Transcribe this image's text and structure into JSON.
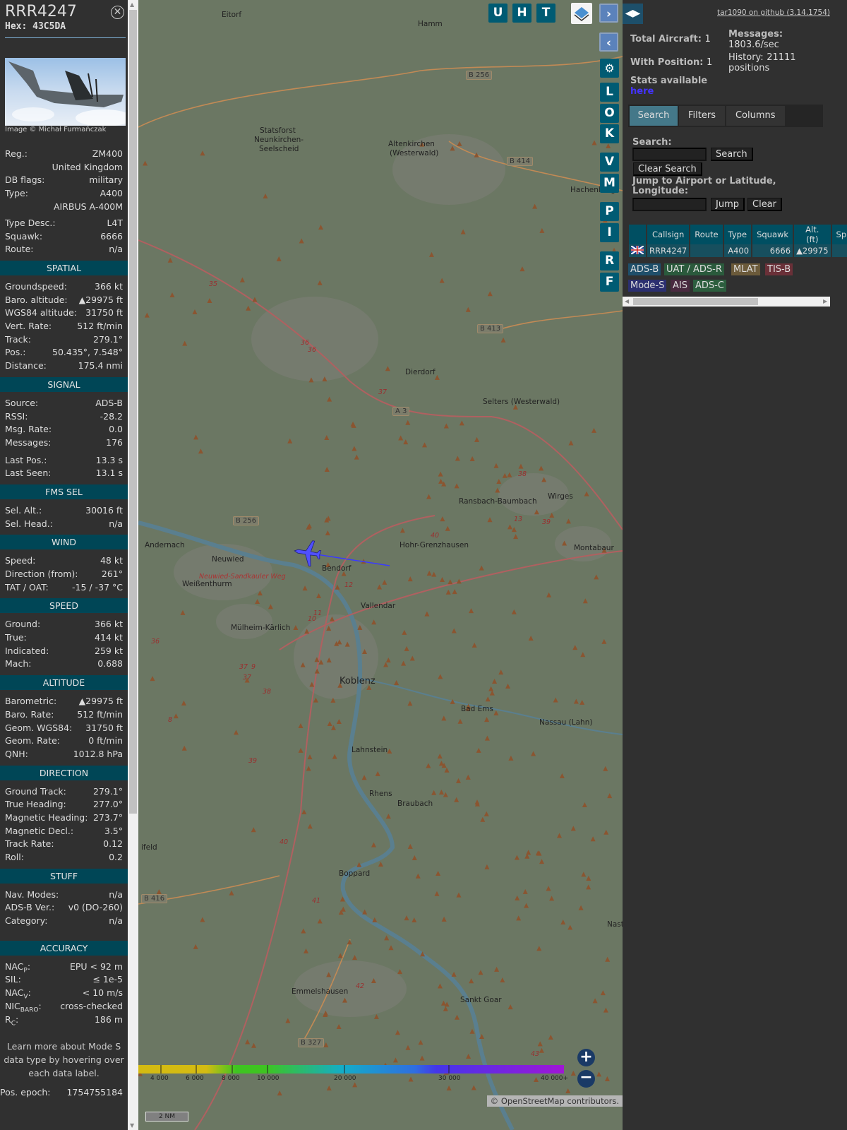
{
  "aircraft": {
    "callsign": "RRR4247",
    "hex_label": "Hex:",
    "hex": "43C5DA",
    "photo_credit": "Image © Michał Furmańczak"
  },
  "info": [
    {
      "label": "Reg.:",
      "value": "ZM400",
      "link": true
    },
    {
      "label": "",
      "value": "United Kingdom"
    },
    {
      "label": "DB flags:",
      "value": "military"
    },
    {
      "label": "Type:",
      "value": "A400"
    },
    {
      "label": "",
      "value": "AIRBUS A-400M"
    },
    {
      "label": "Type Desc.:",
      "value": "L4T",
      "gap": true
    },
    {
      "label": "Squawk:",
      "value": "6666"
    },
    {
      "label": "Route:",
      "value": "n/a"
    }
  ],
  "sections": [
    {
      "title": "SPATIAL",
      "rows": [
        [
          "Groundspeed:",
          "366 kt"
        ],
        [
          "Baro. altitude:",
          "▲29975 ft"
        ],
        [
          "WGS84 altitude:",
          "31750 ft"
        ],
        [
          "Vert. Rate:",
          "512 ft/min"
        ],
        [
          "Track:",
          "279.1°"
        ],
        [
          "Pos.:",
          "50.435°, 7.548°"
        ],
        [
          "Distance:",
          "175.4 nmi"
        ]
      ]
    },
    {
      "title": "SIGNAL",
      "rows": [
        [
          "Source:",
          "ADS-B"
        ],
        [
          "RSSI:",
          "-28.2"
        ],
        [
          "Msg. Rate:",
          "0.0"
        ],
        [
          "Messages:",
          "176"
        ],
        [
          "Last Pos.:",
          "13.3 s"
        ],
        [
          "Last Seen:",
          "13.1 s"
        ]
      ]
    },
    {
      "title": "FMS SEL",
      "rows": [
        [
          "Sel. Alt.:",
          "30016 ft"
        ],
        [
          "Sel. Head.:",
          "n/a"
        ]
      ]
    },
    {
      "title": "WIND",
      "rows": [
        [
          "Speed:",
          "48 kt"
        ],
        [
          "Direction (from):",
          "261°"
        ],
        [
          "TAT / OAT:",
          "-15 / -37 °C"
        ]
      ]
    },
    {
      "title": "SPEED",
      "rows": [
        [
          "Ground:",
          "366 kt"
        ],
        [
          "True:",
          "414 kt"
        ],
        [
          "Indicated:",
          "259 kt"
        ],
        [
          "Mach:",
          "0.688"
        ]
      ]
    },
    {
      "title": "ALTITUDE",
      "rows": [
        [
          "Barometric:",
          "▲29975 ft"
        ],
        [
          "Baro. Rate:",
          "512 ft/min"
        ],
        [
          "Geom. WGS84:",
          "31750 ft"
        ],
        [
          "Geom. Rate:",
          "0 ft/min"
        ],
        [
          "QNH:",
          "1012.8 hPa"
        ]
      ]
    },
    {
      "title": "DIRECTION",
      "rows": [
        [
          "Ground Track:",
          "279.1°"
        ],
        [
          "True Heading:",
          "277.0°"
        ],
        [
          "Magnetic Heading:",
          "273.7°"
        ],
        [
          "Magnetic Decl.:",
          "3.5°"
        ],
        [
          "Track Rate:",
          "0.12"
        ],
        [
          "Roll:",
          "0.2"
        ]
      ]
    },
    {
      "title": "STUFF",
      "rows": [
        [
          "Nav. Modes:",
          "n/a"
        ],
        [
          "ADS-B Ver.:",
          "v0 (DO-260)"
        ],
        [
          "Category:",
          "n/a"
        ]
      ]
    },
    {
      "title": "ACCURACY",
      "rows": [
        [
          "NAC|P|:",
          "EPU < 92 m"
        ],
        [
          "SIL:",
          "≤ 1e-5"
        ],
        [
          "NAC|V|:",
          "< 10 m/s"
        ],
        [
          "NIC|BARO|:",
          "cross-checked"
        ],
        [
          "R|C|:",
          "186 m"
        ]
      ]
    }
  ],
  "note": "Learn more about Mode S data type by hovering over each data label.",
  "pos_epoch": {
    "label": "Pos. epoch:",
    "value": "1754755184"
  },
  "map": {
    "top_buttons": [
      "U",
      "H",
      "T"
    ],
    "side_buttons": [
      "L",
      "O",
      "K",
      "V",
      "M",
      "P",
      "I",
      "R",
      "F"
    ],
    "places": [
      [
        "Eitorf",
        314,
        22
      ],
      [
        "Hamm",
        592,
        35
      ],
      [
        "Statsforst",
        368,
        186
      ],
      [
        "Neunkirchen-",
        360,
        199
      ],
      [
        "Seelscheid",
        367,
        212
      ],
      [
        "Altenkirchen",
        550,
        205
      ],
      [
        "(Westerwald)",
        552,
        218
      ],
      [
        "Hachenburg",
        808,
        270
      ],
      [
        "Dierdorf",
        574,
        528
      ],
      [
        "Selters (Westerwald)",
        684,
        570
      ],
      [
        "Ransbach-Baumbach",
        650,
        711
      ],
      [
        "Wirges",
        776,
        704
      ],
      [
        "Andernach",
        205,
        773
      ],
      [
        "Neuwied",
        300,
        793
      ],
      [
        "Bendorf",
        456,
        806
      ],
      [
        "Hohr-Grenzhausen",
        566,
        773
      ],
      [
        "Montabaur",
        813,
        777
      ],
      [
        "Weißenthurm",
        258,
        828
      ],
      [
        "Vallendar",
        511,
        859
      ],
      [
        "Mülheim-Kärlich",
        327,
        890
      ],
      [
        "Bad Ems",
        653,
        1005
      ],
      [
        "Nassau (Lahn)",
        764,
        1024
      ],
      [
        "Lahnstein",
        498,
        1063
      ],
      [
        "Rhens",
        523,
        1125
      ],
      [
        "Braubach",
        563,
        1139
      ],
      [
        "Boppard",
        480,
        1238
      ],
      [
        "Emmelshausen",
        413,
        1405
      ],
      [
        "Sankt Goar",
        652,
        1417
      ],
      [
        "ifeld",
        200,
        1201
      ],
      [
        "Nast",
        860,
        1310
      ]
    ],
    "big_places": [
      [
        "Koblenz",
        481,
        965
      ]
    ],
    "road_shields": [
      [
        "B 256",
        660,
        108
      ],
      [
        "B 414",
        718,
        230
      ],
      [
        "B 413",
        676,
        467
      ],
      [
        "A 3",
        556,
        584
      ],
      [
        "B 256",
        330,
        739
      ],
      [
        "B 416",
        200,
        1274
      ],
      [
        "B 327",
        422,
        1478
      ]
    ],
    "road_numbers": [
      "35",
      "36",
      "36",
      "37",
      "38",
      "13",
      "39",
      "40",
      "12",
      "11",
      "10",
      "37",
      "9",
      "37",
      "38",
      "8",
      "39",
      "40",
      "41",
      "42",
      "36",
      "43"
    ],
    "weg_label": "Neuwied-Sandkauler Weg",
    "altitude_ticks": [
      "4 000",
      "6 000",
      "8 000",
      "10 000",
      "20 000",
      "30 000",
      "40 000+"
    ],
    "scale": "2 NM",
    "attribution": "© OpenStreetMap contributors."
  },
  "right": {
    "github": "tar1090 on github (3.14.1754)",
    "total_aircraft_label": "Total Aircraft:",
    "total_aircraft": "1",
    "with_position_label": "With Position:",
    "with_position": "1",
    "stats_label": "Stats available",
    "stats_link": "here",
    "messages_label": "Messages:",
    "messages": "1803.6/sec",
    "history_label": "History:",
    "history": "21111",
    "history_unit": "positions",
    "tabs": [
      "Search",
      "Filters",
      "Columns"
    ],
    "search_label": "Search:",
    "search_button": "Search",
    "clear_search": "Clear Search",
    "jump_label": "Jump to Airport or Latitude, Longitude:",
    "jump_button": "Jump",
    "clear_button": "Clear",
    "table": {
      "headers": [
        "",
        "Callsign",
        "Route",
        "Type",
        "Squawk",
        "Alt. (ft)",
        "Sp"
      ],
      "rows": [
        {
          "flag": "uk-flag",
          "callsign": "RRR4247",
          "route": "",
          "type": "A400",
          "squawk": "6666",
          "alt": "▲29975",
          "speed": ""
        }
      ]
    },
    "legend": [
      {
        "label": "ADS-B",
        "color": "#1f4f6a"
      },
      {
        "label": "UAT / ADS-R",
        "color": "#2a5a3c"
      },
      {
        "label": "MLAT",
        "color": "#6b5a3a"
      },
      {
        "label": "TIS-B",
        "color": "#6a3038"
      },
      {
        "label": "Mode-S",
        "color": "#2b2f70"
      },
      {
        "label": "AIS",
        "color": "#4a2a40"
      },
      {
        "label": "ADS-C",
        "color": "#2c5e3e"
      }
    ]
  }
}
